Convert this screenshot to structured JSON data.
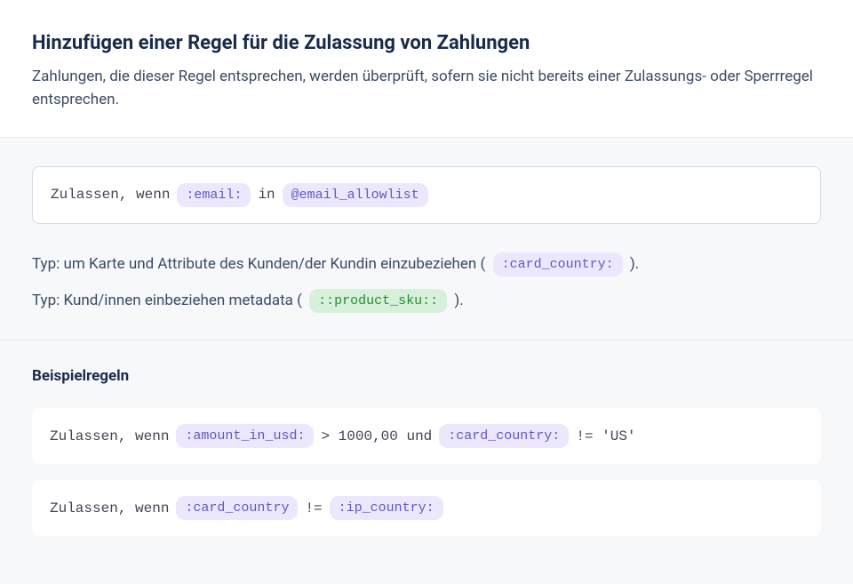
{
  "header": {
    "title": "Hinzufügen einer Regel für die Zulassung von Zahlungen",
    "subtitle": "Zahlungen, die dieser Regel entsprechen, werden überprüft, sofern sie nicht bereits einer Zulassungs- oder Sperrregel entsprechen."
  },
  "rule_input": {
    "prefix": "Zulassen, wenn",
    "token_email": ":email:",
    "operator_in": "in",
    "token_allowlist": "@email_allowlist"
  },
  "hints": {
    "hint1_prefix": "Typ: um Karte und Attribute des Kunden/der Kundin einzubeziehen (",
    "hint1_token": ":card_country:",
    "hint1_suffix": ").",
    "hint2_prefix": "Typ: Kund/innen einbeziehen metadata (",
    "hint2_token": "::product_sku::",
    "hint2_suffix": ")."
  },
  "examples": {
    "title": "Beispielregeln",
    "rule1": {
      "prefix": "Zulassen, wenn",
      "token_amount": ":amount_in_usd:",
      "op1": "> 1000,00 und",
      "token_country": ":card_country:",
      "op2": "!= 'US'"
    },
    "rule2": {
      "prefix": "Zulassen, wenn",
      "token_card_country": ":card_country",
      "op": "!=",
      "token_ip_country": ":ip_country:"
    }
  },
  "colors": {
    "title": "#1a2b4a",
    "text": "#3c4b63",
    "pill_purple_bg": "#ece7fd",
    "pill_purple_fg": "#6259c2",
    "pill_green_bg": "#d7f0d9",
    "pill_green_fg": "#2a8a3a",
    "content_bg": "#f6f8fa"
  }
}
